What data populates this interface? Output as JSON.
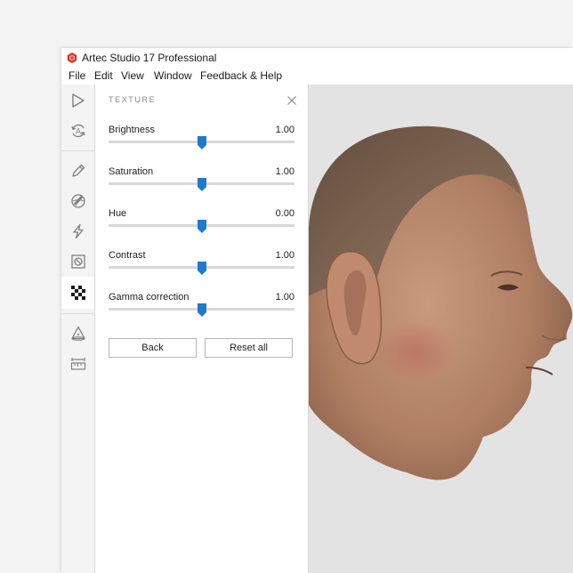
{
  "app": {
    "title": "Artec Studio 17 Professional",
    "brand_color": "#d9342b"
  },
  "menu": [
    "File",
    "Edit",
    "View",
    "Window",
    "Feedback & Help"
  ],
  "toolbar": {
    "tools": [
      {
        "icon": "play-icon"
      },
      {
        "icon": "autopilot-icon",
        "glyph": "A"
      },
      {
        "icon": "pencil-icon"
      },
      {
        "icon": "eraser-icon"
      },
      {
        "icon": "lightning-icon"
      },
      {
        "icon": "mask-icon"
      },
      {
        "icon": "texture-checker-icon",
        "active": true
      },
      {
        "icon": "cone-icon"
      },
      {
        "icon": "ruler-icon"
      }
    ]
  },
  "panel": {
    "title": "TEXTURE",
    "sliders": [
      {
        "label": "Brightness",
        "value": "1.00",
        "position": 0.5
      },
      {
        "label": "Saturation",
        "value": "1.00",
        "position": 0.5
      },
      {
        "label": "Hue",
        "value": "0.00",
        "position": 0.5
      },
      {
        "label": "Contrast",
        "value": "1.00",
        "position": 0.5
      },
      {
        "label": "Gamma correction",
        "value": "1.00",
        "position": 0.5
      }
    ],
    "buttons": {
      "back": "Back",
      "reset": "Reset all"
    },
    "accent": "#1f7acc"
  },
  "viewport": {
    "background": "#e3e3e3",
    "model": "textured-3d-head-scan"
  }
}
